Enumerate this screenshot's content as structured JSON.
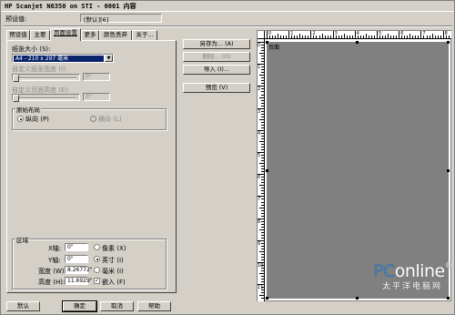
{
  "window": {
    "title": "HP Scanjet N6350 on STI - 0001 内容"
  },
  "preset": {
    "label": "预设值:",
    "value": "[默认][6]"
  },
  "tabs": [
    {
      "label": "预设值"
    },
    {
      "label": "主要"
    },
    {
      "label": "页面设置"
    },
    {
      "label": "更多"
    },
    {
      "label": "颜色丢弃"
    },
    {
      "label": "关于..."
    }
  ],
  "page_setup": {
    "paper_size_label": "纸张大小 (S):",
    "paper_size_value": "A4 - 210 x 297 毫米",
    "custom_width_label": "自定义纸张宽度 (I):",
    "custom_width_value": "0\"",
    "custom_height_label": "自定义页面高度 (E):",
    "custom_height_value": "0\"",
    "orientation": {
      "title": "原始布局",
      "portrait": "纵向 (P)",
      "landscape": "横向 (L)",
      "selected": "portrait"
    }
  },
  "region": {
    "title": "区域",
    "x_label": "X轴:",
    "x_value": "0\"",
    "y_label": "Y轴:",
    "y_value": "0\"",
    "width_label": "宽度 (W):",
    "width_value": "8.26772\"",
    "height_label": "高度 (H):",
    "height_value": "11.6929\"",
    "units": {
      "pixel": "像素 (X)",
      "inch": "英寸 (I)",
      "mm": "毫米 (I)"
    },
    "selected_unit": "inch",
    "fit_label": "嵌入 (F)",
    "fit_checked": true
  },
  "side_buttons": {
    "save_as": "另存为... (A)",
    "delete": "删除... (D)",
    "import": "导入 (I)...",
    "preview": "预览 (V)"
  },
  "bottom_buttons": {
    "default": "默认",
    "ok": "确定",
    "cancel": "取消",
    "help": "帮助"
  },
  "preview": {
    "page_tag": "页面",
    "ruler_top": [
      "0",
      "1",
      "2",
      "3",
      "4",
      "5",
      "6",
      "7",
      "8"
    ],
    "ruler_left": [
      "0",
      "1",
      "2",
      "3",
      "4",
      "5",
      "6",
      "7",
      "8",
      "9",
      "10",
      "11"
    ]
  },
  "watermark": {
    "brand_left": "PC",
    "brand_right": "online",
    "tld": "®",
    "subtitle": "太平洋电脑网"
  }
}
